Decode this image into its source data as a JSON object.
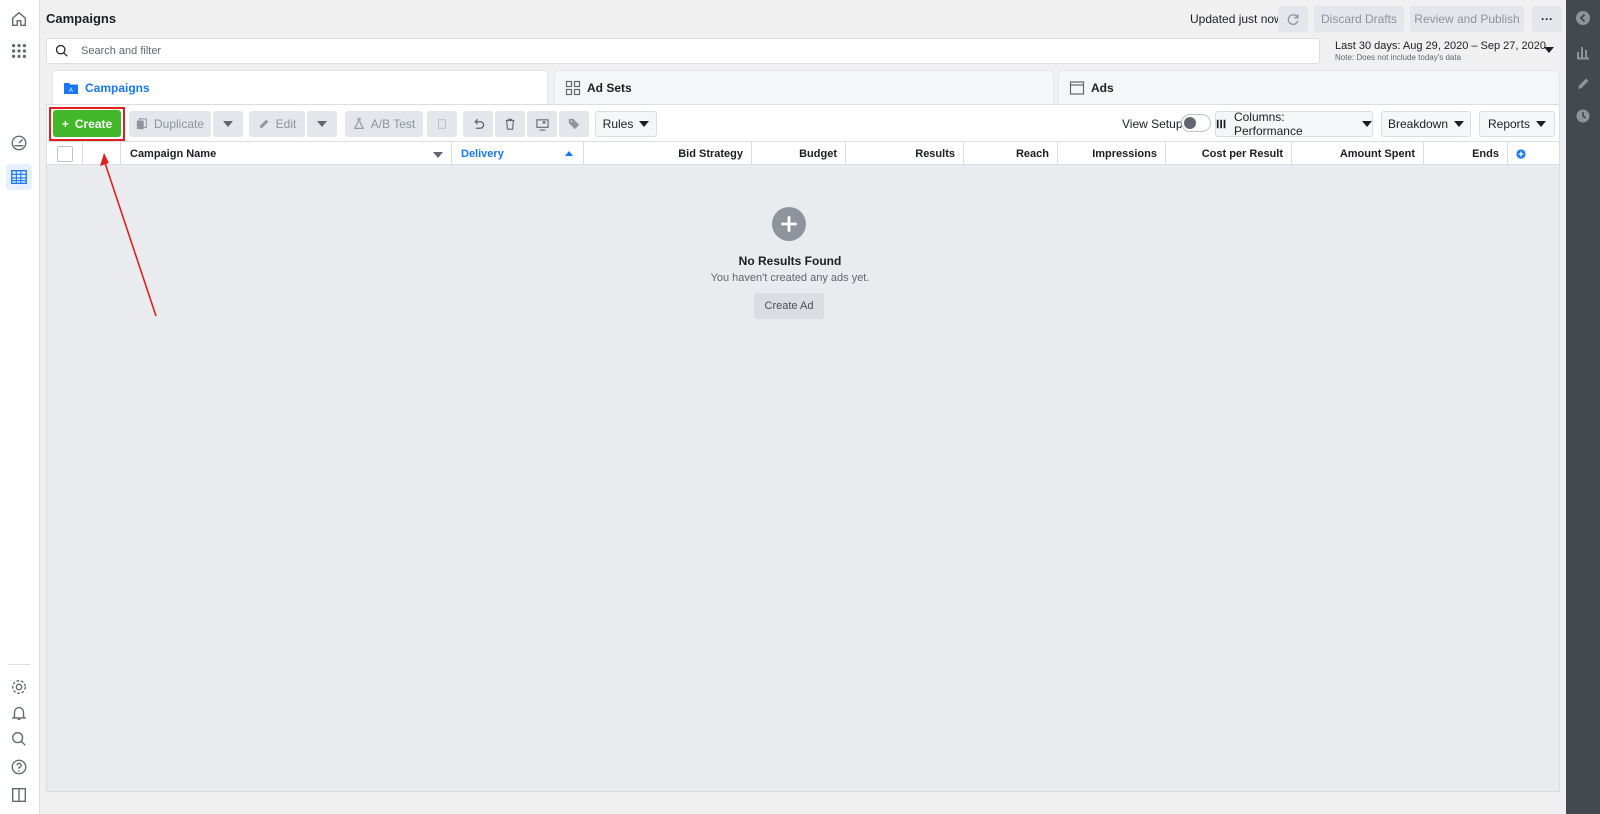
{
  "header": {
    "title": "Campaigns",
    "updated": "Updated just now",
    "discard_label": "Discard Drafts",
    "review_label": "Review and Publish",
    "more_label": "···"
  },
  "search": {
    "placeholder": "Search and filter"
  },
  "date_range": {
    "label": "Last 30 days: Aug 29, 2020 – Sep 27, 2020",
    "note": "Note: Does not include today's data"
  },
  "tabs": [
    {
      "label": "Campaigns"
    },
    {
      "label": "Ad Sets"
    },
    {
      "label": "Ads"
    }
  ],
  "toolbar": {
    "create_label": "Create",
    "duplicate_label": "Duplicate",
    "edit_label": "Edit",
    "ab_test_label": "A/B Test",
    "rules_label": "Rules",
    "view_setup_label": "View Setup",
    "columns_label": "Columns: Performance",
    "breakdown_label": "Breakdown",
    "reports_label": "Reports"
  },
  "table": {
    "columns": [
      "Campaign Name",
      "Delivery",
      "Bid Strategy",
      "Budget",
      "Results",
      "Reach",
      "Impressions",
      "Cost per Result",
      "Amount Spent",
      "Ends"
    ]
  },
  "empty_state": {
    "title": "No Results Found",
    "subtitle": "You haven't created any ads yet.",
    "button_label": "Create Ad"
  },
  "colors": {
    "primary": "#1877f2",
    "create_green": "#42b72a",
    "highlight_red": "#e02020"
  }
}
